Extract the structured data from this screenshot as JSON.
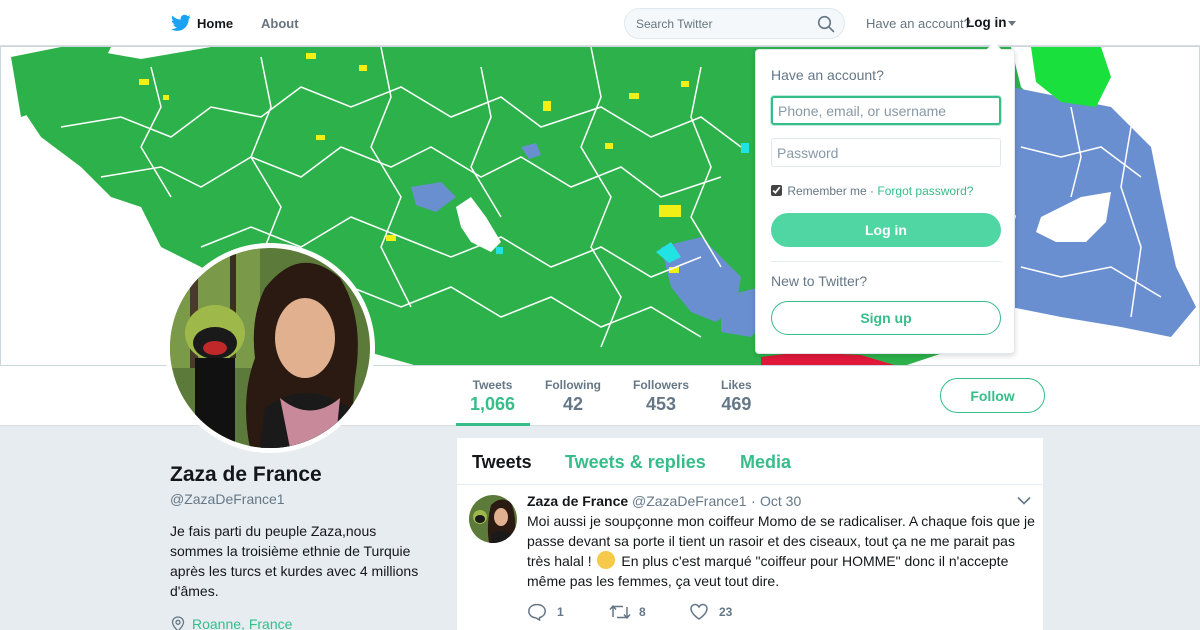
{
  "nav": {
    "logo_icon": "twitter-bird-icon",
    "home_label": "Home",
    "about_label": "About",
    "search_placeholder": "Search Twitter",
    "have_account": "Have an account?",
    "login_label": "Log in"
  },
  "colors": {
    "accent": "#36bd8a",
    "login_button": "#4fd6a3",
    "twitter_blue": "#1da1f2",
    "map_green": "#2db24b",
    "map_blue": "#6a8fd0"
  },
  "profile": {
    "name": "Zaza de France",
    "handle": "@ZazaDeFrance1",
    "bio": "Je fais parti du peuple Zaza,nous sommes la troisième ethnie de Turquie après les turcs et kurdes avec 4 millions d'âmes.",
    "location": "Roanne, France"
  },
  "stats": {
    "tweets_label": "Tweets",
    "tweets_value": "1,066",
    "following_label": "Following",
    "following_value": "42",
    "followers_label": "Followers",
    "followers_value": "453",
    "likes_label": "Likes",
    "likes_value": "469",
    "follow_button": "Follow"
  },
  "timeline": {
    "tabs": [
      "Tweets",
      "Tweets & replies",
      "Media"
    ],
    "tweet": {
      "name": "Zaza de France",
      "handle": "@ZazaDeFrance1",
      "separator": "·",
      "date": "Oct 30",
      "text_before_emoji": "Moi aussi je soupçonne mon coiffeur Momo de se radicaliser. A chaque fois que je passe devant sa porte il tient un rasoir et des ciseaux, tout ça ne me parait pas très halal !",
      "text_after_emoji": "En plus c'est marqué \"coiffeur pour HOMME\" donc il n'accepte même pas les femmes, ça veut tout dire.",
      "emoji": "face-with-rolling-eyes",
      "replies": "1",
      "retweets": "8",
      "likes": "23"
    }
  },
  "login_dropdown": {
    "title": "Have an account?",
    "username_placeholder": "Phone, email, or username",
    "password_placeholder": "Password",
    "remember_label": "Remember me",
    "separator": "·",
    "forgot_label": "Forgot password?",
    "remember_checked": true,
    "login_button": "Log in",
    "new_label": "New to Twitter?",
    "signup_button": "Sign up"
  }
}
